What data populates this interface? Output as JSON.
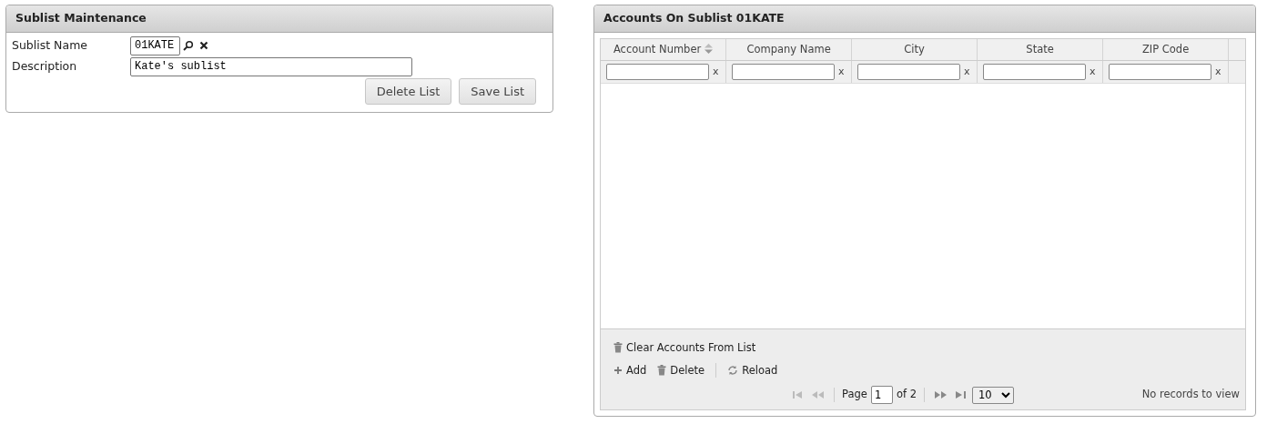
{
  "maintenance": {
    "title": "Sublist Maintenance",
    "fields": [
      {
        "label": "Sublist Name",
        "value": "01KATE",
        "kind": "lookup"
      },
      {
        "label": "Description",
        "value": "Kate's sublist",
        "kind": "text"
      }
    ],
    "buttons": [
      "Delete List",
      "Save List"
    ]
  },
  "accounts": {
    "title": "Accounts On Sublist 01KATE",
    "columns": [
      {
        "label": "Account Number",
        "sortable": true
      },
      {
        "label": "Company Name",
        "sortable": false
      },
      {
        "label": "City",
        "sortable": false
      },
      {
        "label": "State",
        "sortable": false
      },
      {
        "label": "ZIP Code",
        "sortable": false
      }
    ],
    "filter_clear": [
      "x",
      "x",
      "x",
      "x",
      "x"
    ],
    "clear_action": "Clear Accounts From List",
    "toolbar": [
      {
        "label": "Add",
        "kind": "add"
      },
      {
        "label": "Delete",
        "kind": "delete"
      },
      {
        "label": "Reload",
        "kind": "reload"
      }
    ],
    "pager": {
      "first_disabled": true,
      "prev_disabled": true,
      "next_disabled": false,
      "last_disabled": false,
      "page_label": "Page",
      "page": "1",
      "of_label": "of 2",
      "page_size": "10",
      "records": "No records to view"
    }
  }
}
